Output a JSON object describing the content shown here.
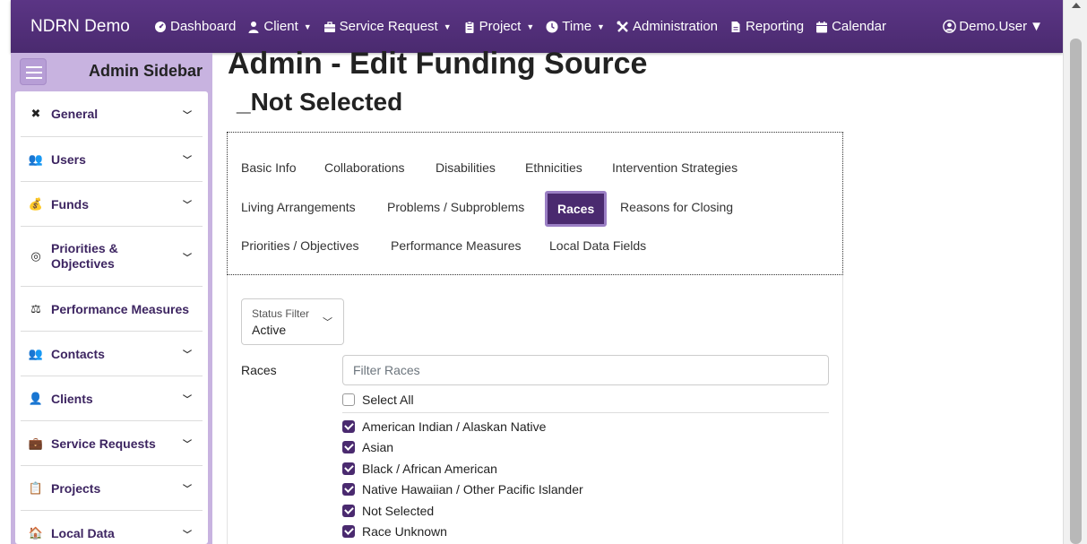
{
  "app": {
    "brand": "NDRN Demo",
    "nav": [
      {
        "label": "Dashboard",
        "icon": "dashboard-icon",
        "dropdown": false
      },
      {
        "label": "Client",
        "icon": "user-icon",
        "dropdown": true
      },
      {
        "label": "Service Request",
        "icon": "briefcase-icon",
        "dropdown": true
      },
      {
        "label": "Project",
        "icon": "clipboard-icon",
        "dropdown": true
      },
      {
        "label": "Time",
        "icon": "clock-icon",
        "dropdown": true
      },
      {
        "label": "Administration",
        "icon": "tools-icon",
        "dropdown": false
      },
      {
        "label": "Reporting",
        "icon": "file-icon",
        "dropdown": false
      },
      {
        "label": "Calendar",
        "icon": "calendar-icon",
        "dropdown": false
      }
    ],
    "user": "Demo.User"
  },
  "sidebar": {
    "title": "Admin Sidebar",
    "items": [
      {
        "label": "General",
        "icon": "tools-icon",
        "chevron": true
      },
      {
        "label": "Users",
        "icon": "users-icon",
        "chevron": true
      },
      {
        "label": "Funds",
        "icon": "money-bag-icon",
        "chevron": true
      },
      {
        "label": "Priorities & Objectives",
        "icon": "target-icon",
        "chevron": true
      },
      {
        "label": "Performance Measures",
        "icon": "scale-icon",
        "chevron": false
      },
      {
        "label": "Contacts",
        "icon": "users-icon",
        "chevron": true
      },
      {
        "label": "Clients",
        "icon": "user-icon",
        "chevron": true
      },
      {
        "label": "Service Requests",
        "icon": "briefcase-icon",
        "chevron": true
      },
      {
        "label": "Projects",
        "icon": "clipboard-icon",
        "chevron": true
      },
      {
        "label": "Local Data",
        "icon": "house-icon",
        "chevron": true
      }
    ]
  },
  "main": {
    "title": "Admin - Edit Funding Source",
    "subtitle": "_Not Selected",
    "tabs": [
      {
        "label": "Basic Info",
        "active": false
      },
      {
        "label": "Collaborations",
        "active": false
      },
      {
        "label": "Disabilities",
        "active": false
      },
      {
        "label": "Ethnicities",
        "active": false
      },
      {
        "label": "Intervention Strategies",
        "active": false
      },
      {
        "label": "Living Arrangements",
        "active": false
      },
      {
        "label": "Problems / Subproblems",
        "active": false
      },
      {
        "label": "Races",
        "active": true
      },
      {
        "label": "Reasons for Closing",
        "active": false
      },
      {
        "label": "Priorities / Objectives",
        "active": false
      },
      {
        "label": "Performance Measures",
        "active": false
      },
      {
        "label": "Local Data Fields",
        "active": false
      }
    ],
    "status_filter": {
      "label": "Status Filter",
      "value": "Active"
    },
    "races": {
      "label": "Races",
      "filter_placeholder": "Filter Races",
      "select_all": {
        "label": "Select All",
        "checked": false
      },
      "options": [
        {
          "label": "American Indian / Alaskan Native",
          "checked": true
        },
        {
          "label": "Asian",
          "checked": true
        },
        {
          "label": "Black / African American",
          "checked": true
        },
        {
          "label": "Native Hawaiian / Other Pacific Islander",
          "checked": true
        },
        {
          "label": "Not Selected",
          "checked": true
        },
        {
          "label": "Race Unknown",
          "checked": true
        }
      ]
    }
  },
  "colors": {
    "primary": "#4a2a6f",
    "sidebar": "#c8b3e0",
    "accent_border": "#9b7fc4"
  }
}
